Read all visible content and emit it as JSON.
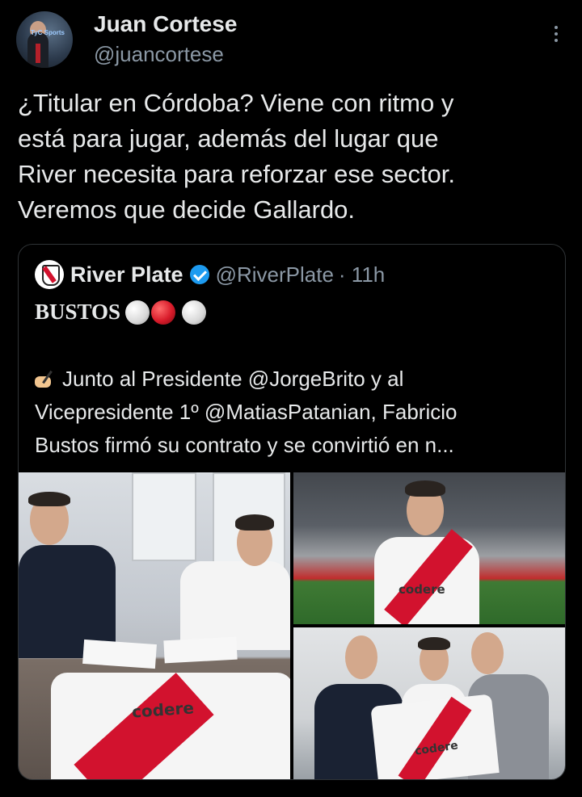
{
  "author": {
    "name": "Juan Cortese",
    "handle": "@juancortese",
    "avatar_badge": "TyC Sports"
  },
  "tweet": {
    "lines": [
      "¿Titular en Córdoba? Viene con ritmo y",
      "está para jugar, además del lugar que",
      "River necesita para reforzar ese sector.",
      "Veremos que decide Gallardo."
    ]
  },
  "quote": {
    "name": "River Plate",
    "handle": "@RiverPlate",
    "time": "· 11h",
    "title": "BUSTOS",
    "title_emojis": [
      "white-ball",
      "red-ball",
      "white-ball"
    ],
    "body_lines": [
      "Junto al Presidente @JorgeBrito y al",
      "Vicepresidente 1º @MatiasPatanian, Fabricio",
      "Bustos firmó su contrato y se convirtió en n..."
    ],
    "jersey_sponsor": "codere"
  },
  "colors": {
    "background": "#000000",
    "text": "#e7e9ea",
    "secondary_text": "#8b98a5",
    "border": "#2f3336",
    "verified": "#1d9bf0",
    "river_red": "#d2122e"
  },
  "icons": [
    "more-options-icon",
    "verified-badge-icon",
    "writing-hand-icon"
  ]
}
